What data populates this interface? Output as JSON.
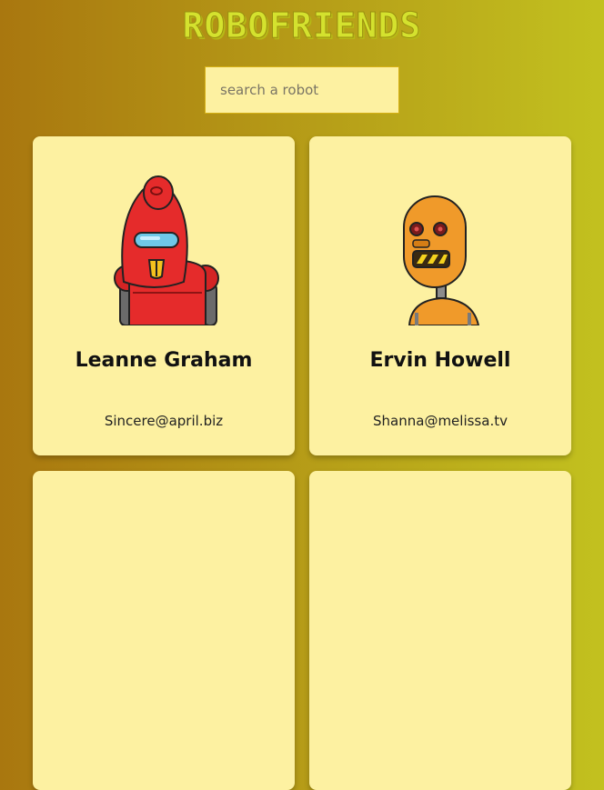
{
  "header": {
    "title": "ROBOFRIENDS"
  },
  "search": {
    "placeholder": "search a robot"
  },
  "robots": [
    {
      "name": "Leanne Graham",
      "email": "Sincere@april.biz"
    },
    {
      "name": "Ervin Howell",
      "email": "Shanna@melissa.tv"
    }
  ],
  "colors": {
    "card_bg": "#fdf1a1",
    "title": "#d4e22e",
    "robot1": "#e52b2b",
    "robot2": "#f09a2a"
  }
}
